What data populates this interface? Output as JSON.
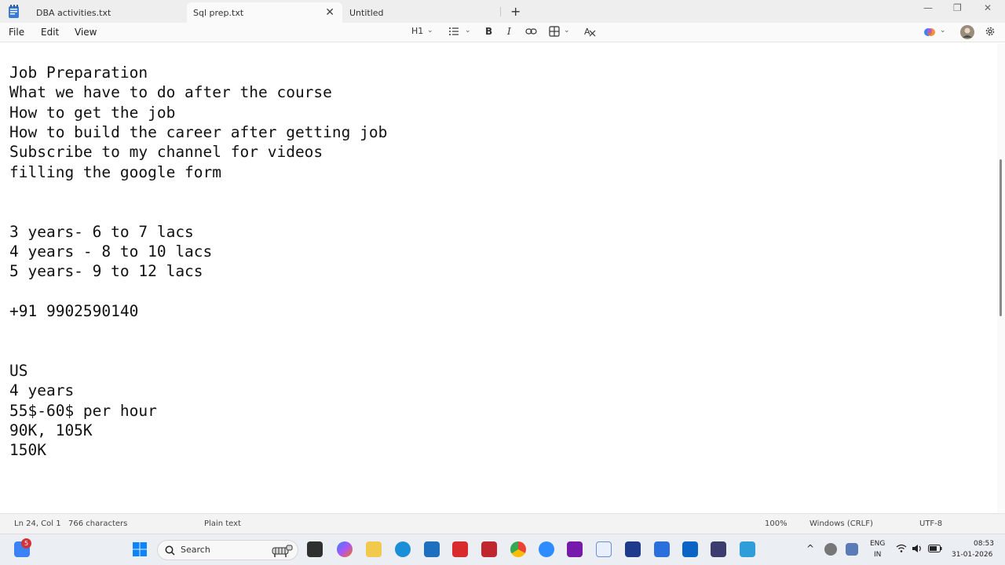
{
  "tabs": [
    {
      "label": "DBA activities.txt",
      "active": false
    },
    {
      "label": "Sql prep.txt",
      "active": true
    },
    {
      "label": "Untitled",
      "active": false
    }
  ],
  "tab_close_glyph": "✕",
  "new_tab_glyph": "+",
  "window_controls": {
    "minimize": "—",
    "maximize": "❐",
    "close": "✕"
  },
  "menu": {
    "file": "File",
    "edit": "Edit",
    "view": "View"
  },
  "toolbar": {
    "heading": "H1",
    "bold": "B",
    "italic": "I"
  },
  "document": {
    "lines": [
      "Job Preparation",
      "What we have to do after the course",
      "How to get the job",
      "How to build the career after getting job",
      "Subscribe to my channel for videos",
      "filling the google form",
      "",
      "",
      "3 years- 6 to 7 lacs",
      "4 years - 8 to 10 lacs",
      "5 years- 9 to 12 lacs",
      "",
      "+91 9902590140",
      "",
      "",
      "US",
      "4 years",
      "55$-60$ per hour",
      "90K, 105K",
      "150K"
    ]
  },
  "status": {
    "position": "Ln 24, Col 1",
    "characters": "766 characters",
    "format": "Plain text",
    "zoom": "100%",
    "line_ending": "Windows (CRLF)",
    "encoding": "UTF-8"
  },
  "taskbar": {
    "search_label": "Search",
    "notification_count": "5",
    "language_line1": "ENG",
    "language_line2": "IN",
    "time": "08:53",
    "date": "31-01-2026",
    "chevron": "^"
  },
  "colors": {
    "accent": "#0067c0",
    "tabbar_bg": "#eeeeee",
    "editor_bg": "#ffffff",
    "taskbar_bg": "#ebeef3"
  }
}
